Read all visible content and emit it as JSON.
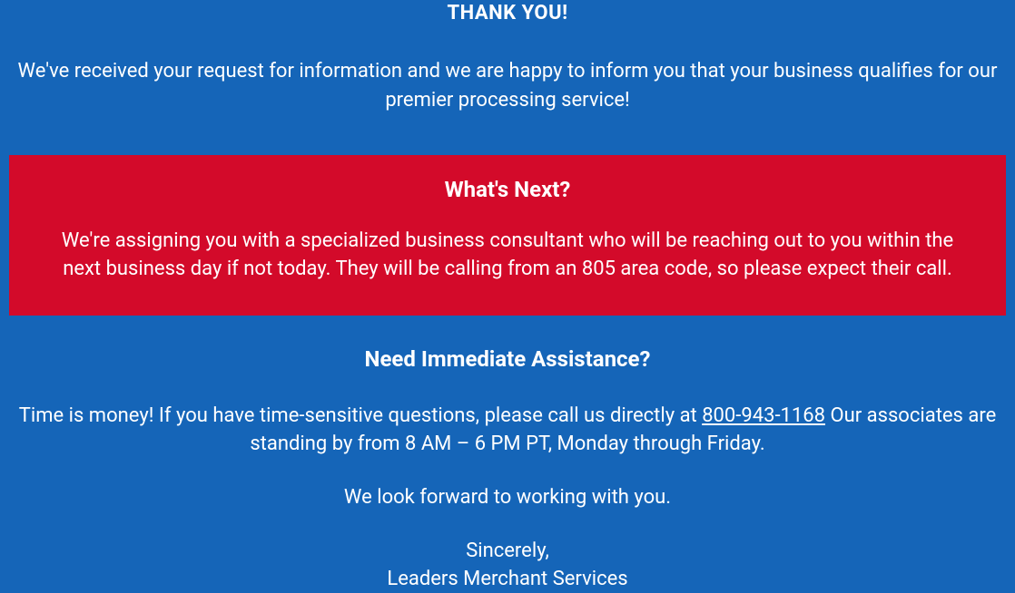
{
  "thank_you_heading": "THANK YOU!",
  "intro": "We've received your request for information and we are happy to inform you that your business qualifies for our premier processing service!",
  "whats_next": {
    "heading": "What's Next?",
    "body": "We're assigning you with a specialized business consultant who will be reaching out to you within the next business day if not today. They will be calling from an 805 area code, so please expect their call."
  },
  "assistance": {
    "heading": "Need Immediate Assistance?",
    "body_before": "Time is money! If you have time-sensitive questions, please call us directly at ",
    "phone": "800-943-1168",
    "body_after": " Our associates are standing by from 8 AM – 6 PM PT, Monday through Friday."
  },
  "closing": "We look forward to working with you.",
  "signature": {
    "line1": "Sincerely,",
    "line2": "Leaders Merchant Services"
  }
}
